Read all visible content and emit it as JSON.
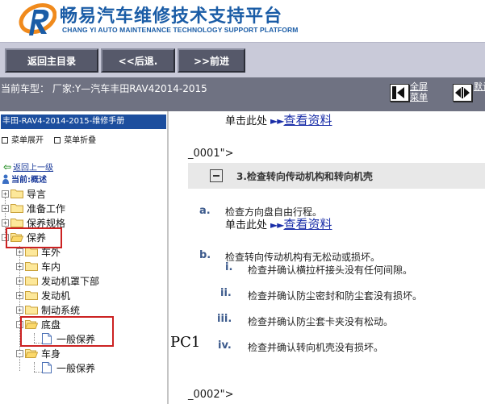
{
  "header": {
    "title": "畅易汽车维修技术支持平台",
    "subtitle": "CHANG YI AUTO MAINTENANCE TECHNOLOGY SUPPORT PLATFORM",
    "logo_icon": "r-swoosh-logo-icon",
    "colors": {
      "title": "#1a5ca6",
      "logo_orange": "#f08a1c"
    }
  },
  "toolbar": {
    "home_label": "返回主目录",
    "back_label": "<<后退.",
    "forward_label": ">>前进"
  },
  "vehicle_bar": {
    "text": "当前车型：  厂家:Y—汽车丰田RAV42014-2015",
    "fullscreen_label": "全屏菜单",
    "default_label": "默认"
  },
  "sidebar": {
    "title": "丰田-RAV4-2014-2015-维修手册",
    "expand_label": "菜单展开",
    "collapse_label": "菜单折叠",
    "up_level_label": "返回上一级",
    "current_label": "当前:概述",
    "tree": [
      {
        "label": "导言",
        "expander": "+"
      },
      {
        "label": "准备工作",
        "expander": "+"
      },
      {
        "label": "保养规格",
        "expander": "+"
      },
      {
        "label": "保养",
        "expander": "-"
      },
      {
        "label": "车外",
        "expander": "+"
      },
      {
        "label": "车内",
        "expander": "+"
      },
      {
        "label": "发动机罩下部",
        "expander": "+"
      },
      {
        "label": "发动机",
        "expander": "+"
      },
      {
        "label": "制动系统",
        "expander": "+"
      },
      {
        "label": "底盘",
        "expander": "-"
      },
      {
        "label": "一般保养",
        "expander": ""
      },
      {
        "label": "车身",
        "expander": "-"
      },
      {
        "label": "一般保养",
        "expander": ""
      }
    ]
  },
  "main": {
    "top_link_prefix": "单击此处",
    "top_link_arrow": "►►",
    "top_link_text": "查看资料",
    "code_line_1": "_0001\">",
    "section_title": "3.检查转向传动机构和转向机壳",
    "step_a": {
      "label": "a.",
      "text": "检查方向盘自由行程。",
      "link_prefix": "单击此处",
      "link_arrow": "►►",
      "link_text": "查看资料"
    },
    "step_b": {
      "label": "b.",
      "text": "检查转向传动机构有无松动或损坏。",
      "substeps": [
        {
          "label": "i.",
          "text": "检查并确认横拉杆接头没有任何间隙。"
        },
        {
          "label": "ii.",
          "text": "检查并确认防尘密封和防尘套没有损坏。"
        },
        {
          "label": "iii.",
          "text": "检查并确认防尘套卡夹没有松动。"
        },
        {
          "label": "iv.",
          "text": "检查并确认转向机壳没有损坏。"
        }
      ]
    },
    "code_line_2": "_0002\">",
    "overlay_label": "PC1",
    "colors": {
      "link": "#1a2ea8",
      "step_label": "#3c5a8c",
      "section_bg": "#e8e8e8"
    }
  }
}
